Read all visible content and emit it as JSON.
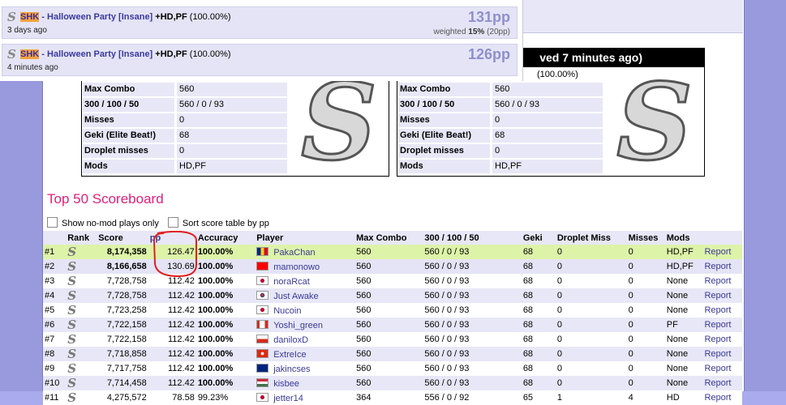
{
  "popup": {
    "entries": [
      {
        "artist": "SHK",
        "separator": " - ",
        "song": "Halloween Party [Insane]",
        "mods": " +HD,PF",
        "accuracy": " (100.00%)",
        "when": "3 days ago",
        "pp": "131pp",
        "weighted_label": "weighted",
        "weighted_pct": "15%",
        "weighted_pp": "(20pp)"
      },
      {
        "artist": "SHK",
        "separator": " - ",
        "song": "Halloween Party [Insane]",
        "mods": " +HD,PF",
        "accuracy": " (100.00%)",
        "when": "4 minutes ago",
        "pp": "126pp"
      }
    ]
  },
  "stat_panels": [
    {
      "header_partial": "",
      "accuracy_partial": "",
      "rows": [
        {
          "label": "Max Combo",
          "value": "560"
        },
        {
          "label": "300 / 100 / 50",
          "value": "560 / 0 / 93"
        },
        {
          "label": "Misses",
          "value": "0"
        },
        {
          "label": "Geki (Elite Beat!)",
          "value": "68"
        },
        {
          "label": "Droplet misses",
          "value": "0"
        },
        {
          "label": "Mods",
          "value": "HD,PF"
        }
      ]
    },
    {
      "header_partial": "ved 7 minutes ago)",
      "accuracy_partial": "(100.00%)",
      "rows": [
        {
          "label": "Max Combo",
          "value": "560"
        },
        {
          "label": "300 / 100 / 50",
          "value": "560 / 0 / 93"
        },
        {
          "label": "Misses",
          "value": "0"
        },
        {
          "label": "Geki (Elite Beat!)",
          "value": "68"
        },
        {
          "label": "Droplet misses",
          "value": "0"
        },
        {
          "label": "Mods",
          "value": "HD,PF"
        }
      ]
    }
  ],
  "scoreboard": {
    "title": "Top 50 Scoreboard",
    "option_nomod": "Show no-mod plays only",
    "option_sort": "Sort score table by pp",
    "columns": [
      "",
      "Rank",
      "Score",
      "pp",
      "Accuracy",
      "Player",
      "Max Combo",
      "300 / 100 / 50",
      "Geki",
      "Droplet Miss",
      "Misses",
      "Mods",
      ""
    ],
    "rows": [
      {
        "pos": "#1",
        "score": "8,174,358",
        "pp": "126.47",
        "acc": "100.00%",
        "player": "PakaChan",
        "flag": "ro",
        "combo": "560",
        "hits": "560  /  0  /  93",
        "geki": "68",
        "droplet": "0",
        "misses": "0",
        "mods": "HD,PF",
        "report": "Report"
      },
      {
        "pos": "#2",
        "score": "8,166,658",
        "pp": "130.69",
        "acc": "100.00%",
        "player": "mamonowo",
        "flag": "tw",
        "combo": "560",
        "hits": "560  /  0  /  93",
        "geki": "68",
        "droplet": "0",
        "misses": "0",
        "mods": "HD,PF",
        "report": "Report"
      },
      {
        "pos": "#3",
        "score": "7,728,758",
        "pp": "112.42",
        "acc": "100.00%",
        "player": "noraRcat",
        "flag": "jp",
        "combo": "560",
        "hits": "560  /  0  /  93",
        "geki": "68",
        "droplet": "0",
        "misses": "0",
        "mods": "None",
        "report": "Report"
      },
      {
        "pos": "#4",
        "score": "7,728,758",
        "pp": "112.42",
        "acc": "100.00%",
        "player": "Just Awake",
        "flag": "kr",
        "combo": "560",
        "hits": "560  /  0  /  93",
        "geki": "68",
        "droplet": "0",
        "misses": "0",
        "mods": "None",
        "report": "Report"
      },
      {
        "pos": "#5",
        "score": "7,723,258",
        "pp": "112.42",
        "acc": "100.00%",
        "player": "Nucoin",
        "flag": "jp",
        "combo": "560",
        "hits": "560  /  0  /  93",
        "geki": "68",
        "droplet": "0",
        "misses": "0",
        "mods": "None",
        "report": "Report"
      },
      {
        "pos": "#6",
        "score": "7,722,158",
        "pp": "112.42",
        "acc": "100.00%",
        "player": "Yoshi_green",
        "flag": "ca",
        "combo": "560",
        "hits": "560  /  0  /  93",
        "geki": "68",
        "droplet": "0",
        "misses": "0",
        "mods": "PF",
        "report": "Report"
      },
      {
        "pos": "#7",
        "score": "7,722,158",
        "pp": "112.42",
        "acc": "100.00%",
        "player": "daniloxD",
        "flag": "cl",
        "combo": "560",
        "hits": "560  /  0  /  93",
        "geki": "68",
        "droplet": "0",
        "misses": "0",
        "mods": "None",
        "report": "Report"
      },
      {
        "pos": "#8",
        "score": "7,718,858",
        "pp": "112.42",
        "acc": "100.00%",
        "player": "ExtreIce",
        "flag": "hk",
        "combo": "560",
        "hits": "560  /  0  /  93",
        "geki": "68",
        "droplet": "0",
        "misses": "0",
        "mods": "None",
        "report": "Report"
      },
      {
        "pos": "#9",
        "score": "7,717,758",
        "pp": "112.42",
        "acc": "100.00%",
        "player": "jakincses",
        "flag": "au",
        "combo": "560",
        "hits": "560  /  0  /  93",
        "geki": "68",
        "droplet": "0",
        "misses": "0",
        "mods": "None",
        "report": "Report"
      },
      {
        "pos": "#10",
        "score": "7,714,458",
        "pp": "112.42",
        "acc": "100.00%",
        "player": "kisbee",
        "flag": "hu",
        "combo": "560",
        "hits": "560  /  0  /  93",
        "geki": "68",
        "droplet": "0",
        "misses": "0",
        "mods": "None",
        "report": "Report"
      },
      {
        "pos": "#11",
        "score": "4,275,572",
        "pp": "78.58",
        "acc": "99.23%",
        "player": "jetter14",
        "flag": "jp",
        "combo": "364",
        "hits": "556  /  0  /  92",
        "geki": "65",
        "droplet": "1",
        "misses": "4",
        "mods": "HD",
        "report": "Report"
      }
    ]
  },
  "colors": {
    "accent_pink": "#e0207a",
    "link": "#3a3a9a",
    "gold_row": "#ddf3a8",
    "annotation": "#e02020"
  }
}
